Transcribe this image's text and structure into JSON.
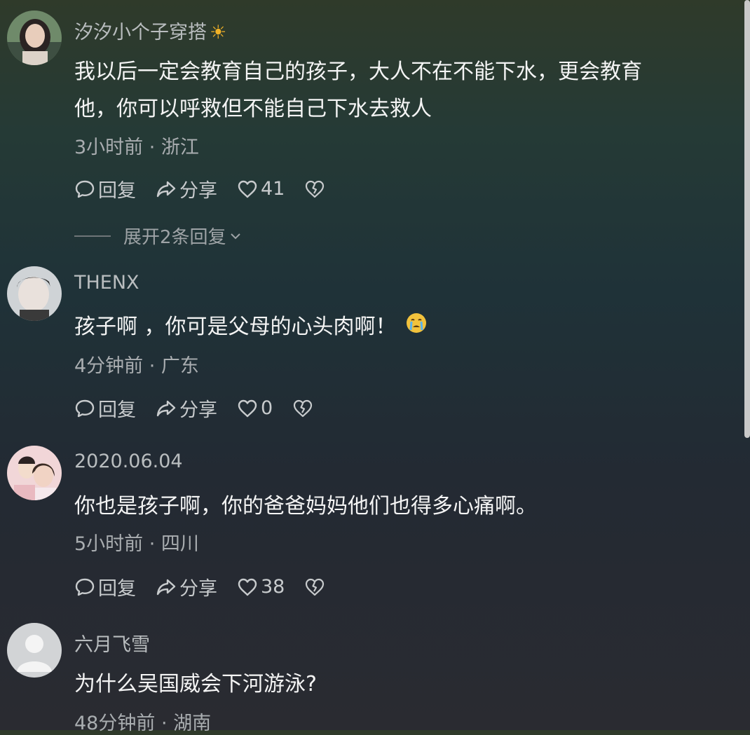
{
  "comments": [
    {
      "username": "汐汐小个子穿搭",
      "username_badge": "☀",
      "text_line1": "我以后一定会教育自己的孩子，大人不在不能下水，更会教育",
      "text_line2": "他，你可以呼救但不能自己下水去救人",
      "meta": "3小时前 · 浙江",
      "reply_label": "回复",
      "share_label": "分享",
      "likes": "41",
      "expand_label": "展开2条回复"
    },
    {
      "username": "THENX",
      "text_line1": "孩子啊 ，你可是父母的心头肉啊！",
      "emoji": "crying-face",
      "meta": "4分钟前 · 广东",
      "reply_label": "回复",
      "share_label": "分享",
      "likes": "0"
    },
    {
      "username": "2020.06.04",
      "text_line1": "你也是孩子啊，你的爸爸妈妈他们也得多心痛啊。",
      "meta": "5小时前 · 四川",
      "reply_label": "回复",
      "share_label": "分享",
      "likes": "38"
    },
    {
      "username": "六月飞雪",
      "text_line1": "为什么吴国威会下河游泳?",
      "meta": "48分钟前 · 湖南"
    }
  ],
  "colors": {
    "accent_emoji": "#f2c23c"
  }
}
